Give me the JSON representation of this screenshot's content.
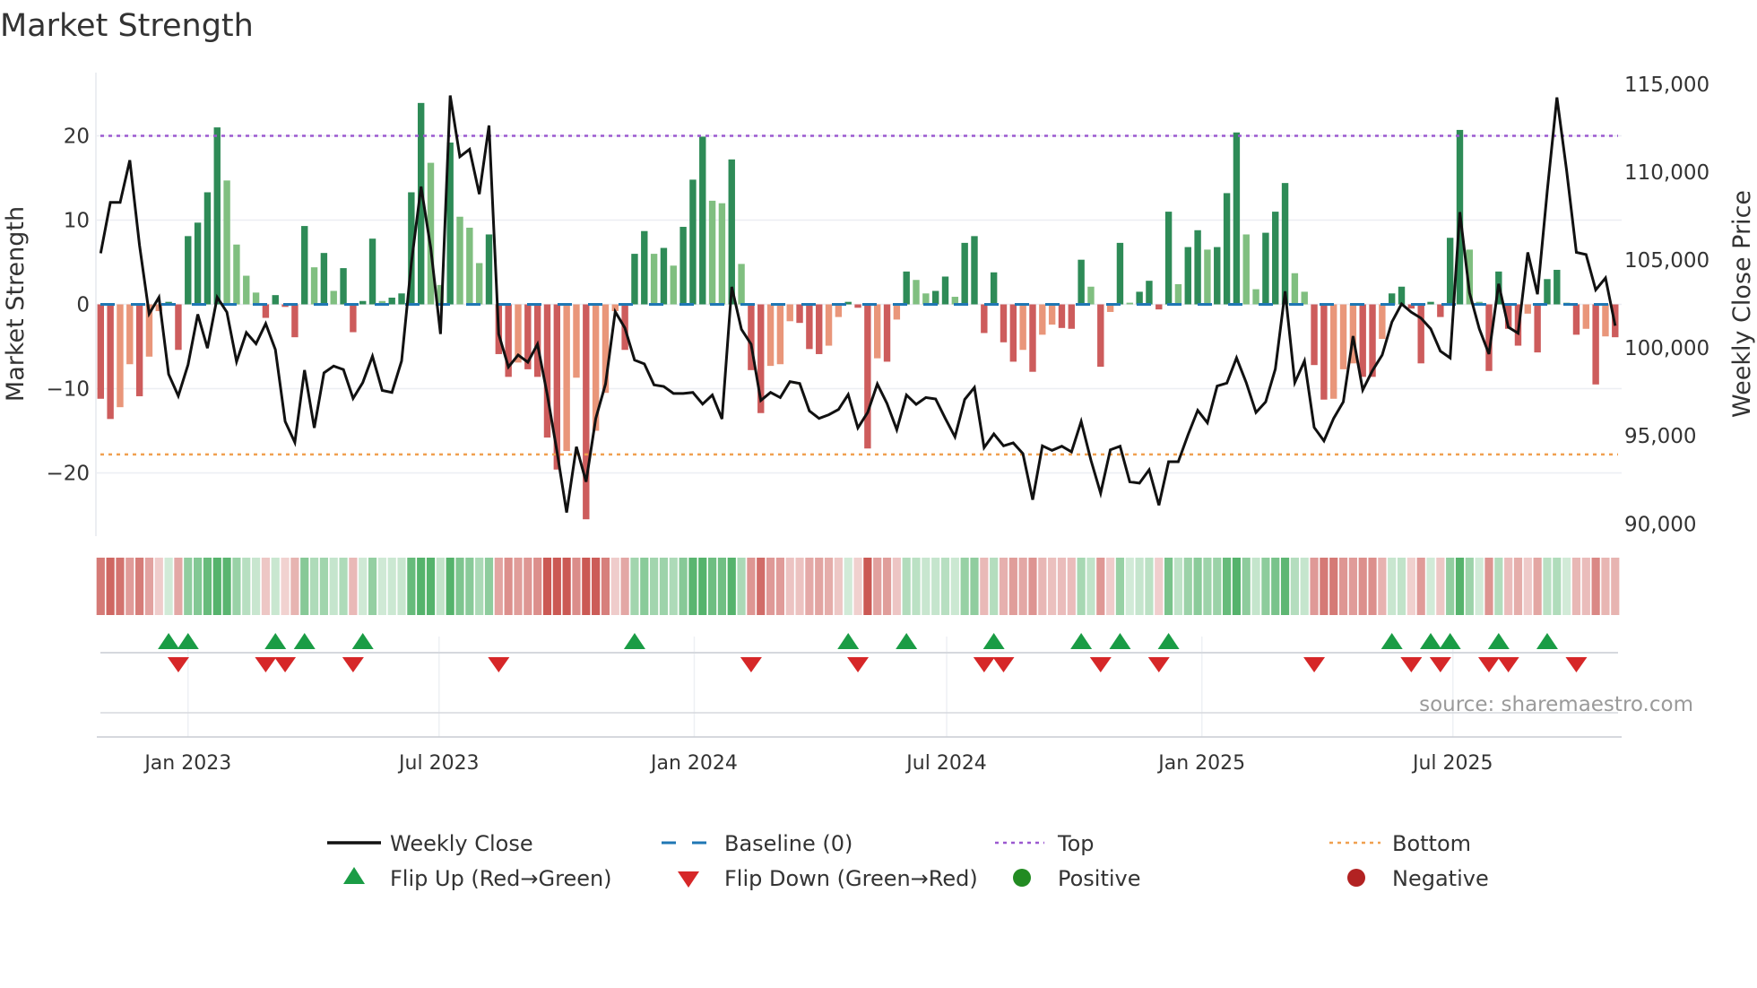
{
  "title": "Market Strength",
  "source": "source: sharemaestro.com",
  "colors": {
    "pos_strong": "#2e8b57",
    "pos_weak": "#80bf80",
    "neg_strong": "#cd5c5c",
    "neg_weak": "#e9967a",
    "line": "#111111",
    "baseline": "#1f77b4",
    "top": "#9b59d0",
    "bottom": "#f0a050",
    "flip_up": "#1a9c45",
    "flip_down": "#d62728",
    "positive": "#228b22",
    "negative": "#b22222"
  },
  "legend": {
    "weekly_close": "Weekly Close",
    "baseline": "Baseline (0)",
    "top": "Top",
    "bottom": "Bottom",
    "flip_up": "Flip Up (Red→Green)",
    "flip_down": "Flip Down (Green→Red)",
    "positive": "Positive",
    "negative": "Negative"
  },
  "chart_data": {
    "type": "bar",
    "title": "Market Strength",
    "ylabel": "Market Strength",
    "y2label": "Weekly Close Price",
    "ylim": [
      -27.5,
      27.5
    ],
    "y2lim": [
      89300,
      115650
    ],
    "yticks": [
      {
        "value": 20,
        "label": "20"
      },
      {
        "value": 10,
        "label": "10"
      },
      {
        "value": 0,
        "label": "0"
      },
      {
        "value": -10,
        "label": "−10"
      },
      {
        "value": -20,
        "label": "−20"
      }
    ],
    "y2ticks": [
      {
        "value": 115000,
        "label": "115,000"
      },
      {
        "value": 110000,
        "label": "110,000"
      },
      {
        "value": 105000,
        "label": "105,000"
      },
      {
        "value": 100000,
        "label": "100,000"
      },
      {
        "value": 95000,
        "label": "95,000"
      },
      {
        "value": 90000,
        "label": "90,000"
      }
    ],
    "xticks": [
      {
        "date": "2023-01-01",
        "label": "Jan 2023"
      },
      {
        "date": "2023-07-01",
        "label": "Jul 2023"
      },
      {
        "date": "2024-01-01",
        "label": "Jan 2024"
      },
      {
        "date": "2024-07-01",
        "label": "Jul 2024"
      },
      {
        "date": "2025-01-01",
        "label": "Jan 2025"
      },
      {
        "date": "2025-07-01",
        "label": "Jul 2025"
      }
    ],
    "x_start": "2022-10-30",
    "x_step_days": 7,
    "top_level": 20,
    "bottom_level": -17.8,
    "baseline": 0,
    "strength": [
      -11.2,
      -13.6,
      -12.2,
      -7.1,
      -10.9,
      -6.2,
      -0.8,
      0.3,
      -5.4,
      8.1,
      9.7,
      13.3,
      21.0,
      14.7,
      7.1,
      3.4,
      1.4,
      -1.6,
      1.1,
      -0.3,
      -3.9,
      9.3,
      4.4,
      6.1,
      1.6,
      4.3,
      -3.3,
      0.4,
      7.8,
      0.4,
      0.8,
      1.3,
      13.3,
      23.9,
      16.8,
      2.3,
      19.2,
      10.4,
      9.1,
      4.9,
      8.3,
      -5.9,
      -8.6,
      -6.9,
      -7.7,
      -8.6,
      -15.8,
      -19.6,
      -17.4,
      -8.7,
      -25.5,
      -15.0,
      -10.5,
      -0.8,
      -5.4,
      6.0,
      8.7,
      6.0,
      6.7,
      4.6,
      9.2,
      14.8,
      19.9,
      12.3,
      12.0,
      17.2,
      4.8,
      -7.8,
      -12.9,
      -7.3,
      -7.1,
      -2.0,
      -2.2,
      -5.3,
      -5.9,
      -4.9,
      -1.5,
      0.3,
      -0.4,
      -17.1,
      -6.4,
      -6.8,
      -1.8,
      3.9,
      2.9,
      1.3,
      1.6,
      3.3,
      0.9,
      7.3,
      8.1,
      -3.4,
      3.8,
      -4.5,
      -6.8,
      -5.4,
      -8.0,
      -3.6,
      -2.4,
      -2.8,
      -2.9,
      5.3,
      2.1,
      -7.4,
      -0.9,
      7.3,
      0.2,
      1.5,
      2.8,
      -0.6,
      11.0,
      2.4,
      6.8,
      8.8,
      6.5,
      6.8,
      13.2,
      20.4,
      8.3,
      1.8,
      8.5,
      11.0,
      14.4,
      3.7,
      1.5,
      -7.2,
      -11.3,
      -11.2,
      -7.7,
      -7.0,
      -8.6,
      -8.6,
      -4.1,
      1.3,
      2.1,
      -0.5,
      -7.0,
      0.3,
      -1.5,
      7.9,
      20.7,
      6.5,
      0.3,
      -7.9,
      3.9,
      -2.9,
      -4.9,
      -1.1,
      -5.7,
      3.0,
      4.1,
      0.2,
      -3.6,
      -2.9,
      -9.5,
      -3.8,
      -3.9
    ],
    "weekly_close": [
      105380,
      108270,
      108270,
      110670,
      105850,
      101940,
      102880,
      98510,
      97270,
      99050,
      101910,
      99990,
      102880,
      102030,
      99220,
      100870,
      100240,
      101380,
      99900,
      95820,
      94630,
      98740,
      95450,
      98580,
      98970,
      98770,
      97130,
      98030,
      99530,
      97580,
      97470,
      99260,
      104830,
      109170,
      105680,
      100790,
      114350,
      110870,
      111290,
      108740,
      112650,
      100790,
      98920,
      99600,
      99190,
      100210,
      97350,
      94120,
      90640,
      94380,
      92390,
      95990,
      97950,
      102060,
      101130,
      99310,
      99090,
      97900,
      97810,
      97410,
      97410,
      97470,
      96810,
      97320,
      95960,
      103470,
      101060,
      100210,
      97010,
      97470,
      97180,
      98080,
      97980,
      96420,
      95990,
      96200,
      96500,
      97350,
      95450,
      96330,
      97950,
      96840,
      95350,
      97320,
      96790,
      97180,
      97100,
      95990,
      94940,
      97070,
      97750,
      94330,
      95110,
      94430,
      94600,
      93990,
      91370,
      94430,
      94180,
      94410,
      94090,
      95820,
      93610,
      91740,
      94210,
      94410,
      92390,
      92310,
      93070,
      91060,
      93530,
      93530,
      95060,
      96450,
      95740,
      97830,
      98000,
      99430,
      98030,
      96330,
      96930,
      98800,
      103220,
      98030,
      99260,
      95480,
      94720,
      95990,
      96930,
      100670,
      97610,
      98710,
      99600,
      101470,
      102500,
      102030,
      101690,
      101090,
      99820,
      99430,
      107720,
      103130,
      101090,
      99650,
      103640,
      101180,
      100840,
      105430,
      103050,
      108910,
      114240,
      110100,
      105430,
      105310,
      103300,
      103980,
      101260
    ],
    "flip_up_weeks": [
      8,
      10,
      19,
      22,
      28,
      56,
      78,
      84,
      93,
      102,
      106,
      111,
      134,
      138,
      140,
      145,
      150
    ],
    "flip_down_weeks": [
      9,
      18,
      20,
      27,
      42,
      68,
      79,
      92,
      94,
      104,
      110,
      126,
      136,
      139,
      144,
      146,
      153
    ],
    "legend_position": "bottom"
  }
}
